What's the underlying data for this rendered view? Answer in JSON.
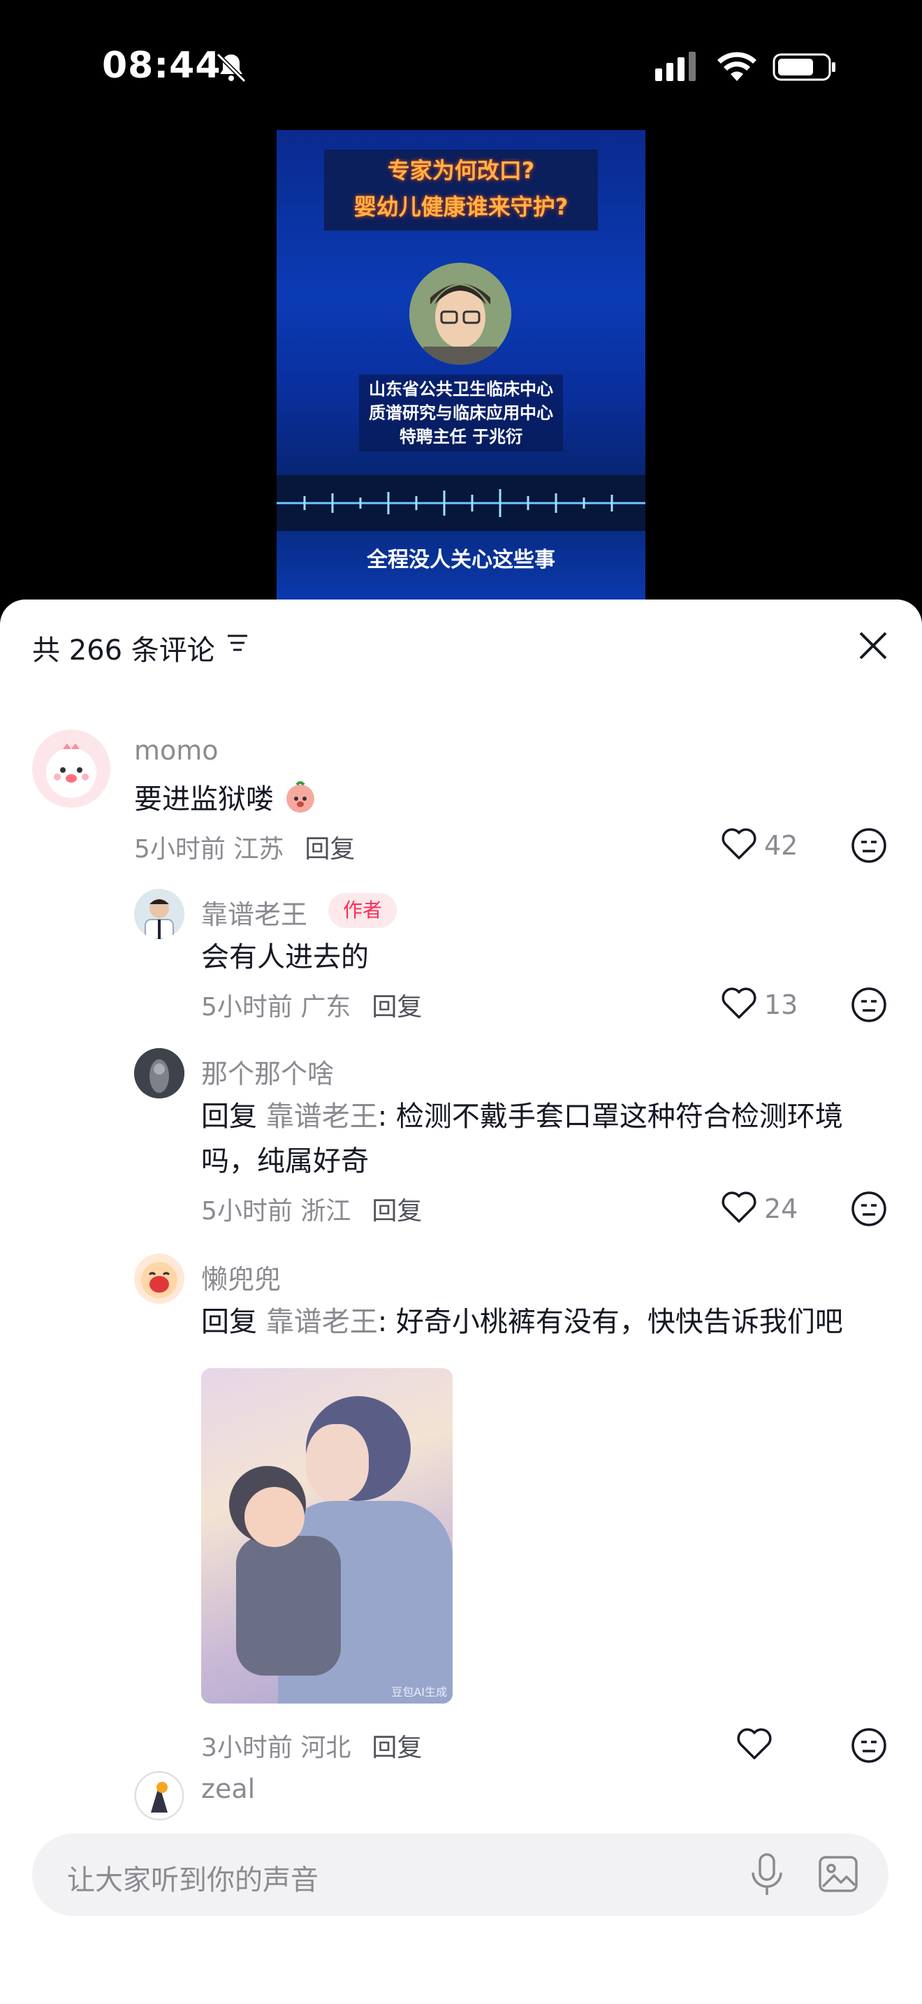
{
  "status_bar": {
    "time": "08:44"
  },
  "video": {
    "title_line1": "专家为何改口?",
    "title_line2": "婴幼儿健康谁来守护?",
    "org_line1": "山东省公共卫生临床中心",
    "org_line2": "质谱研究与临床应用中心",
    "org_line3": "特聘主任 于兆衍",
    "subtitle": "全程没人关心这些事"
  },
  "comments_header": {
    "title": "共 266 条评论"
  },
  "comments": [
    {
      "user": "momo",
      "text": "要进监狱喽",
      "time_location": "5小时前 江苏",
      "reply_label": "回复",
      "likes": "42"
    },
    {
      "user": "靠谱老王",
      "author_badge": "作者",
      "text": "会有人进去的",
      "time_location": "5小时前 广东",
      "reply_label": "回复",
      "likes": "13"
    },
    {
      "user": "那个那个啥",
      "reply_prefix": "回复",
      "reply_to": "靠谱老王",
      "text_line1": ": 检测不戴手套口罩这种符合检测环境",
      "text_line2": "吗，纯属好奇",
      "time_location": "5小时前 浙江",
      "reply_label": "回复",
      "likes": "24"
    },
    {
      "user": "懒兜兜",
      "reply_prefix": "回复",
      "reply_to": "靠谱老王",
      "text": ": 好奇小桃裤有没有，快快告诉我们吧",
      "image_watermark": "豆包AI生成",
      "time_location": "3小时前 河北",
      "reply_label": "回复"
    },
    {
      "user": "zeal"
    }
  ],
  "input": {
    "placeholder": "让大家听到你的声音"
  }
}
